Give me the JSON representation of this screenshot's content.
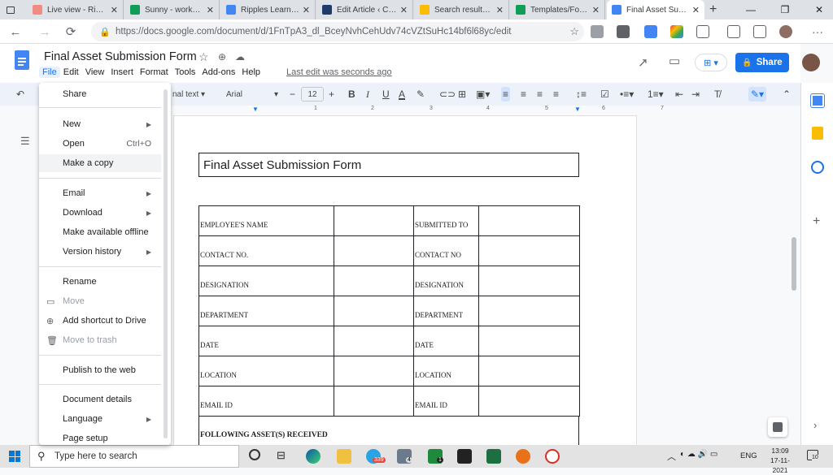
{
  "browser": {
    "tabs": [
      {
        "title": "Live view - Ripple",
        "fav_color": "#f28b82"
      },
      {
        "title": "Sunny - workshee",
        "fav_color": "#0f9d58"
      },
      {
        "title": "Ripples Learning",
        "fav_color": "#4285f4"
      },
      {
        "title": "Edit Article ‹ CHR",
        "fav_color": "#1f3b6b"
      },
      {
        "title": "Search results - G",
        "fav_color": "#fbbc04"
      },
      {
        "title": "Templates/Forms",
        "fav_color": "#0f9d58"
      },
      {
        "title": "Final Asset Subm",
        "fav_color": "#4285f4"
      }
    ],
    "url": "https://docs.google.com/document/d/1FnTpA3_dl_BceyNvhCehUdv74cVZtSuHc14bf6l68yc/edit"
  },
  "doc": {
    "title": "Final Asset Submission Form",
    "menus": [
      "File",
      "Edit",
      "View",
      "Insert",
      "Format",
      "Tools",
      "Add-ons",
      "Help"
    ],
    "last_edit": "Last edit was seconds ago",
    "share_label": "Share"
  },
  "toolbar": {
    "style": "nal text",
    "font": "Arial",
    "font_size": "12"
  },
  "ruler": {
    "ticks": [
      "1",
      "2",
      "3",
      "4",
      "5",
      "6",
      "7"
    ]
  },
  "file_menu": {
    "items": [
      {
        "label": "Share",
        "shortcut": "",
        "arrow": false,
        "disabled": false
      },
      {
        "label": "New",
        "shortcut": "",
        "arrow": true,
        "disabled": false
      },
      {
        "label": "Open",
        "shortcut": "Ctrl+O",
        "arrow": false,
        "disabled": false
      },
      {
        "label": "Make a copy",
        "shortcut": "",
        "arrow": false,
        "disabled": false
      },
      {
        "label": "Email",
        "shortcut": "",
        "arrow": true,
        "disabled": false
      },
      {
        "label": "Download",
        "shortcut": "",
        "arrow": true,
        "disabled": false
      },
      {
        "label": "Make available offline",
        "shortcut": "",
        "arrow": false,
        "disabled": false
      },
      {
        "label": "Version history",
        "shortcut": "",
        "arrow": true,
        "disabled": false
      },
      {
        "label": "Rename",
        "shortcut": "",
        "arrow": false,
        "disabled": false
      },
      {
        "label": "Move",
        "shortcut": "",
        "arrow": false,
        "disabled": true
      },
      {
        "label": "Add shortcut to Drive",
        "shortcut": "",
        "arrow": false,
        "disabled": false
      },
      {
        "label": "Move to trash",
        "shortcut": "",
        "arrow": false,
        "disabled": true
      },
      {
        "label": "Publish to the web",
        "shortcut": "",
        "arrow": false,
        "disabled": false
      },
      {
        "label": "Document details",
        "shortcut": "",
        "arrow": false,
        "disabled": false
      },
      {
        "label": "Language",
        "shortcut": "",
        "arrow": true,
        "disabled": false
      },
      {
        "label": "Page setup",
        "shortcut": "",
        "arrow": false,
        "disabled": false
      }
    ]
  },
  "form": {
    "title": "Final Asset Submission Form",
    "rows": [
      {
        "left": "EMPLOYEE'S NAME",
        "right": "SUBMITTED TO"
      },
      {
        "left": "CONTACT NO.",
        "right": "CONTACT NO"
      },
      {
        "left": "DESIGNATION",
        "right": "DESIGNATION"
      },
      {
        "left": "DEPARTMENT",
        "right": "DEPARTMENT"
      },
      {
        "left": "DATE",
        "right": "DATE"
      },
      {
        "left": "LOCATION",
        "right": "LOCATION"
      },
      {
        "left": "EMAIL ID",
        "right": "EMAIL ID"
      }
    ],
    "assets_heading": "FOLLOWING ASSET(S) RECEIVED"
  },
  "taskbar": {
    "search_placeholder": "Type here to search",
    "lang": "ENG",
    "time": "13:09",
    "date": "17-11-2021",
    "badge_telegram": "339",
    "badge_mail": "4",
    "badge_teams": "1",
    "notif_count": "10"
  }
}
